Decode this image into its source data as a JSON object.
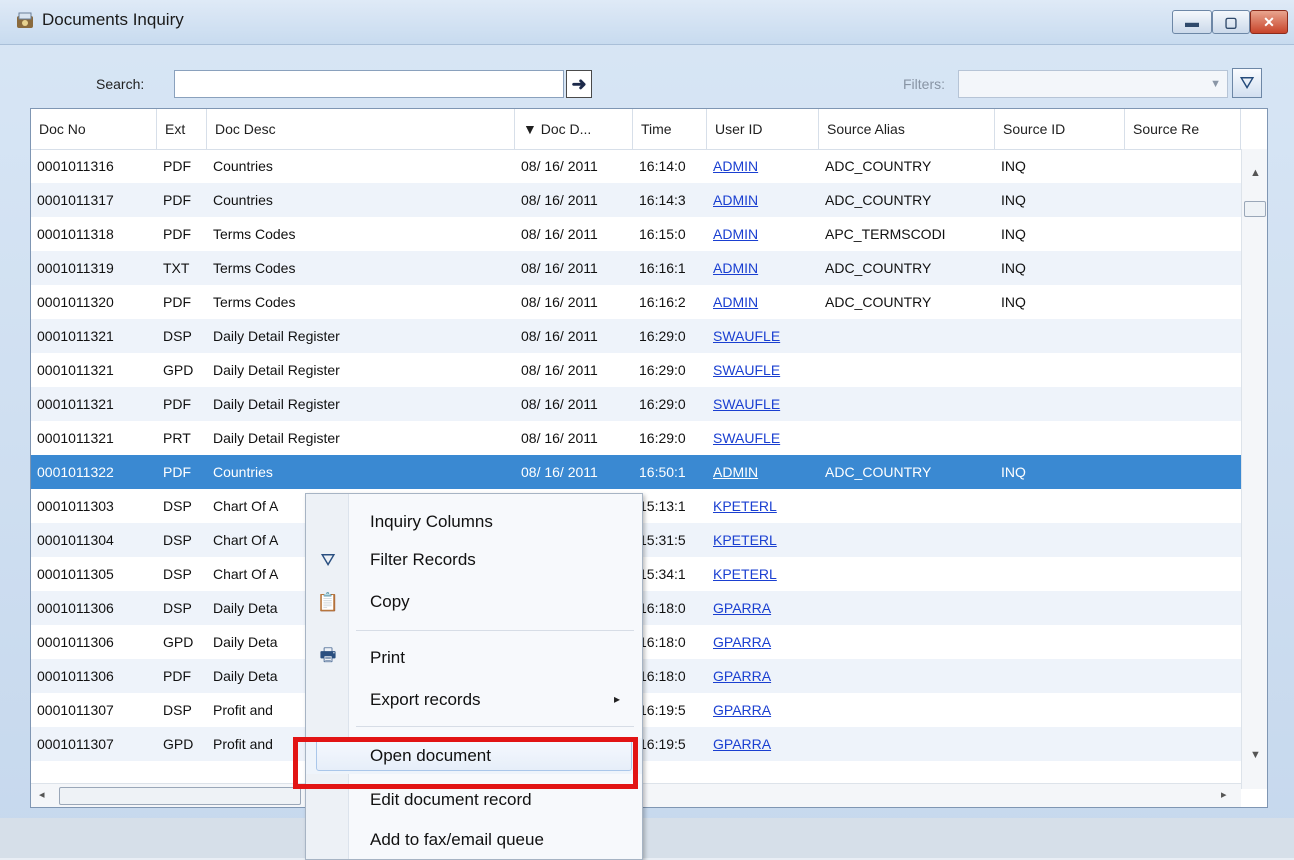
{
  "window": {
    "title": "Documents Inquiry",
    "minimize_glyph": "▬",
    "maximize_glyph": "▢",
    "close_glyph": "✕"
  },
  "toolbar": {
    "search_label": "Search:",
    "search_value": "",
    "go_glyph": "➜",
    "filters_label": "Filters:",
    "filters_value": "",
    "filter_glyph": "⛛"
  },
  "columns": [
    {
      "label": "Doc No"
    },
    {
      "label": "Ext"
    },
    {
      "label": "Doc Desc"
    },
    {
      "label": "▼ Doc D..."
    },
    {
      "label": "Time"
    },
    {
      "label": "User ID"
    },
    {
      "label": "Source Alias"
    },
    {
      "label": "Source ID"
    },
    {
      "label": "Source Re"
    }
  ],
  "rows": [
    {
      "doc_no": "0001011316",
      "ext": "PDF",
      "desc": "Countries",
      "date": "08/ 16/ 2011",
      "time": "16:14:0",
      "user": "ADMIN",
      "alias": "ADC_COUNTRY",
      "sid": "INQ",
      "sre": ""
    },
    {
      "doc_no": "0001011317",
      "ext": "PDF",
      "desc": "Countries",
      "date": "08/ 16/ 2011",
      "time": "16:14:3",
      "user": "ADMIN",
      "alias": "ADC_COUNTRY",
      "sid": "INQ",
      "sre": ""
    },
    {
      "doc_no": "0001011318",
      "ext": "PDF",
      "desc": "Terms Codes",
      "date": "08/ 16/ 2011",
      "time": "16:15:0",
      "user": "ADMIN",
      "alias": "APC_TERMSCODI",
      "sid": "INQ",
      "sre": ""
    },
    {
      "doc_no": "0001011319",
      "ext": "TXT",
      "desc": "Terms Codes",
      "date": "08/ 16/ 2011",
      "time": "16:16:1",
      "user": "ADMIN",
      "alias": "ADC_COUNTRY",
      "sid": "INQ",
      "sre": ""
    },
    {
      "doc_no": "0001011320",
      "ext": "PDF",
      "desc": "Terms Codes",
      "date": "08/ 16/ 2011",
      "time": "16:16:2",
      "user": "ADMIN",
      "alias": "ADC_COUNTRY",
      "sid": "INQ",
      "sre": ""
    },
    {
      "doc_no": "0001011321",
      "ext": "DSP",
      "desc": "Daily Detail Register",
      "date": "08/ 16/ 2011",
      "time": "16:29:0",
      "user": "SWAUFLE",
      "alias": "",
      "sid": "",
      "sre": ""
    },
    {
      "doc_no": "0001011321",
      "ext": "GPD",
      "desc": "Daily Detail Register",
      "date": "08/ 16/ 2011",
      "time": "16:29:0",
      "user": "SWAUFLE",
      "alias": "",
      "sid": "",
      "sre": ""
    },
    {
      "doc_no": "0001011321",
      "ext": "PDF",
      "desc": "Daily Detail Register",
      "date": "08/ 16/ 2011",
      "time": "16:29:0",
      "user": "SWAUFLE",
      "alias": "",
      "sid": "",
      "sre": ""
    },
    {
      "doc_no": "0001011321",
      "ext": "PRT",
      "desc": "Daily Detail Register",
      "date": "08/ 16/ 2011",
      "time": "16:29:0",
      "user": "SWAUFLE",
      "alias": "",
      "sid": "",
      "sre": ""
    },
    {
      "doc_no": "0001011322",
      "ext": "PDF",
      "desc": "Countries",
      "date": "08/ 16/ 2011",
      "time": "16:50:1",
      "user": "ADMIN",
      "alias": "ADC_COUNTRY",
      "sid": "INQ",
      "sre": "",
      "selected": true
    },
    {
      "doc_no": "0001011303",
      "ext": "DSP",
      "desc": "Chart Of A",
      "date": "",
      "time": "15:13:1",
      "user": "KPETERL",
      "alias": "",
      "sid": "",
      "sre": ""
    },
    {
      "doc_no": "0001011304",
      "ext": "DSP",
      "desc": "Chart Of A",
      "date": "",
      "time": "15:31:5",
      "user": "KPETERL",
      "alias": "",
      "sid": "",
      "sre": ""
    },
    {
      "doc_no": "0001011305",
      "ext": "DSP",
      "desc": "Chart Of A",
      "date": "",
      "time": "15:34:1",
      "user": "KPETERL",
      "alias": "",
      "sid": "",
      "sre": ""
    },
    {
      "doc_no": "0001011306",
      "ext": "DSP",
      "desc": "Daily Deta",
      "date": "",
      "time": "16:18:0",
      "user": "GPARRA",
      "alias": "",
      "sid": "",
      "sre": ""
    },
    {
      "doc_no": "0001011306",
      "ext": "GPD",
      "desc": "Daily Deta",
      "date": "",
      "time": "16:18:0",
      "user": "GPARRA",
      "alias": "",
      "sid": "",
      "sre": ""
    },
    {
      "doc_no": "0001011306",
      "ext": "PDF",
      "desc": "Daily Deta",
      "date": "",
      "time": "16:18:0",
      "user": "GPARRA",
      "alias": "",
      "sid": "",
      "sre": ""
    },
    {
      "doc_no": "0001011307",
      "ext": "DSP",
      "desc": "Profit and",
      "date": "",
      "time": "16:19:5",
      "user": "GPARRA",
      "alias": "",
      "sid": "",
      "sre": ""
    },
    {
      "doc_no": "0001011307",
      "ext": "GPD",
      "desc": "Profit and",
      "date": "",
      "time": "16:19:5",
      "user": "GPARRA",
      "alias": "",
      "sid": "",
      "sre": ""
    }
  ],
  "context_menu": {
    "items": [
      {
        "label": "Inquiry Columns",
        "icon": "",
        "icon_name": ""
      },
      {
        "label": "Filter Records",
        "icon": "⛛",
        "icon_name": "filter-icon"
      },
      {
        "label": "Copy",
        "icon": "📋",
        "icon_name": "copy-icon"
      },
      {
        "label": "Print",
        "icon": "🖶",
        "icon_name": "printer-icon"
      },
      {
        "label": "Export records",
        "icon": "",
        "icon_name": "",
        "submenu_arrow": "▸"
      },
      {
        "label": "Open document",
        "icon": "",
        "icon_name": "",
        "hot": true
      },
      {
        "label": "Edit document record",
        "icon": "",
        "icon_name": ""
      },
      {
        "label": "Add to fax/email queue",
        "icon": "",
        "icon_name": ""
      }
    ]
  },
  "scroll": {
    "up": "▲",
    "down": "▼",
    "left": "◂",
    "right": "▸"
  },
  "colors": {
    "selection": "#3a89d2",
    "link": "#1a3fd1",
    "highlight_box": "#e21414"
  }
}
